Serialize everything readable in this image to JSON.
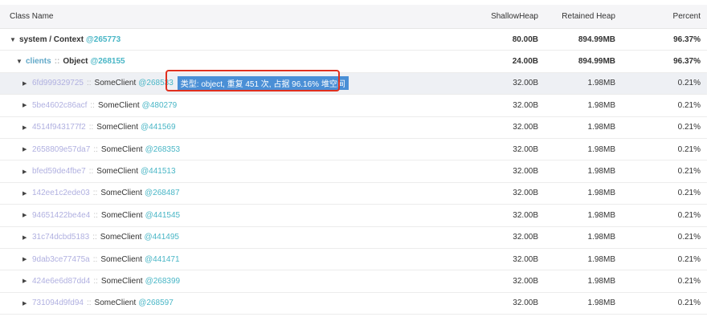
{
  "columns": {
    "name": "Class Name",
    "shallow": "ShallowHeap",
    "retained": "Retained Heap",
    "percent": "Percent"
  },
  "root": {
    "label": "system / Context",
    "addr": "@265773",
    "shallow": "80.00B",
    "retained": "894.99MB",
    "percent": "96.37%"
  },
  "clients": {
    "id": "clients",
    "sep": "::",
    "type": "Object",
    "addr": "@268155",
    "shallow": "24.00B",
    "retained": "894.99MB",
    "percent": "96.37%"
  },
  "tooltip": "类型: object, 重复 451 次, 占据 96.16% 堆空间",
  "rows": [
    {
      "id": "6fd999329725",
      "sep": "::",
      "type": "SomeClient",
      "addr": "@268533",
      "shallow": "32.00B",
      "retained": "1.98MB",
      "percent": "0.21%"
    },
    {
      "id": "5be4602c86acf",
      "sep": "::",
      "type": "SomeClient",
      "addr": "@480279",
      "shallow": "32.00B",
      "retained": "1.98MB",
      "percent": "0.21%"
    },
    {
      "id": "4514f943177f2",
      "sep": "::",
      "type": "SomeClient",
      "addr": "@441569",
      "shallow": "32.00B",
      "retained": "1.98MB",
      "percent": "0.21%"
    },
    {
      "id": "2658809e57da7",
      "sep": "::",
      "type": "SomeClient",
      "addr": "@268353",
      "shallow": "32.00B",
      "retained": "1.98MB",
      "percent": "0.21%"
    },
    {
      "id": "bfed59de4fbe7",
      "sep": "::",
      "type": "SomeClient",
      "addr": "@441513",
      "shallow": "32.00B",
      "retained": "1.98MB",
      "percent": "0.21%"
    },
    {
      "id": "142ee1c2ede03",
      "sep": "::",
      "type": "SomeClient",
      "addr": "@268487",
      "shallow": "32.00B",
      "retained": "1.98MB",
      "percent": "0.21%"
    },
    {
      "id": "94651422be4e4",
      "sep": "::",
      "type": "SomeClient",
      "addr": "@441545",
      "shallow": "32.00B",
      "retained": "1.98MB",
      "percent": "0.21%"
    },
    {
      "id": "31c74dcbd5183",
      "sep": "::",
      "type": "SomeClient",
      "addr": "@441495",
      "shallow": "32.00B",
      "retained": "1.98MB",
      "percent": "0.21%"
    },
    {
      "id": "9dab3ce77475a",
      "sep": "::",
      "type": "SomeClient",
      "addr": "@441471",
      "shallow": "32.00B",
      "retained": "1.98MB",
      "percent": "0.21%"
    },
    {
      "id": "424e6e6d87dd4",
      "sep": "::",
      "type": "SomeClient",
      "addr": "@268399",
      "shallow": "32.00B",
      "retained": "1.98MB",
      "percent": "0.21%"
    },
    {
      "id": "731094d9fd94",
      "sep": "::",
      "type": "SomeClient",
      "addr": "@268597",
      "shallow": "32.00B",
      "retained": "1.98MB",
      "percent": "0.21%"
    }
  ],
  "icons": {
    "expanded": "caret-down-icon",
    "collapsed": "caret-right-icon"
  }
}
